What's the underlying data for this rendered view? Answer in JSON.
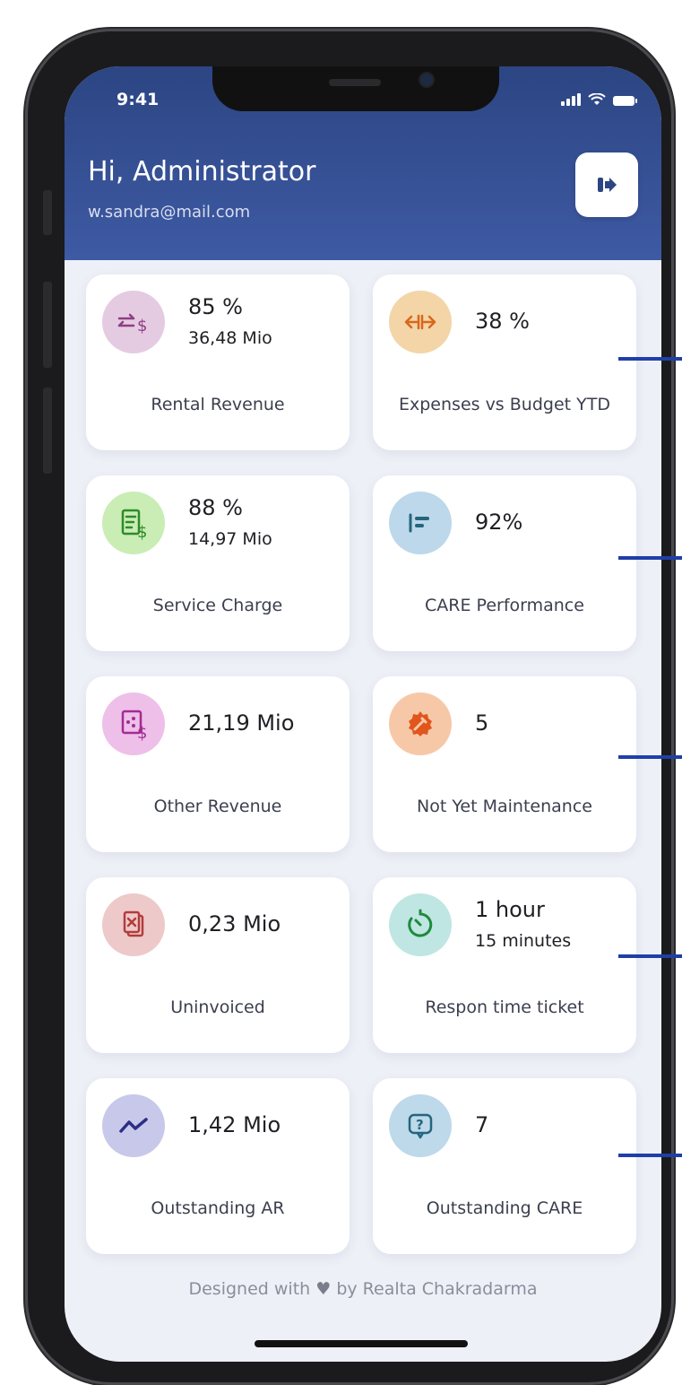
{
  "status_bar": {
    "time": "9:41"
  },
  "header": {
    "greeting": "Hi, Administrator",
    "email": "w.sandra@mail.com",
    "logout_icon": "logout-icon"
  },
  "cards": [
    {
      "value": "85 %",
      "sub": "36,48 Mio",
      "label": "Rental Revenue",
      "icon": "exchange-dollar-icon",
      "color": "#e5cbe2",
      "icon_color": "#8e3e83"
    },
    {
      "value": "38 %",
      "sub": "",
      "label": "Expenses vs Budget YTD",
      "icon": "arrows-split-icon",
      "color": "#f3d5a8",
      "icon_color": "#d9671c"
    },
    {
      "value": "88 %",
      "sub": "14,97 Mio",
      "label": "Service Charge",
      "icon": "receipt-dollar-icon",
      "color": "#c9edb4",
      "icon_color": "#2f8a2a"
    },
    {
      "value": "92%",
      "sub": "",
      "label": "CARE Performance",
      "icon": "bar-list-icon",
      "color": "#bcd8ea",
      "icon_color": "#25657d"
    },
    {
      "value": "21,19 Mio",
      "sub": "",
      "label": "Other Revenue",
      "icon": "document-dollar-icon",
      "color": "#eebfe8",
      "icon_color": "#a32b94"
    },
    {
      "value": "5",
      "sub": "",
      "label": "Not Yet Maintenance",
      "icon": "gear-wrench-icon",
      "color": "#f7c8a8",
      "icon_color": "#e0561d"
    },
    {
      "value": "0,23 Mio",
      "sub": "",
      "label": "Uninvoiced",
      "icon": "invoice-cancel-icon",
      "color": "#eec9c9",
      "icon_color": "#b23c3c"
    },
    {
      "value": "1 hour",
      "sub": "15 minutes",
      "label": "Respon time ticket",
      "icon": "timer-icon",
      "color": "#bfe6e2",
      "icon_color": "#1f8a3d"
    },
    {
      "value": "1,42 Mio",
      "sub": "",
      "label": "Outstanding AR",
      "icon": "trend-line-icon",
      "color": "#c8c8ea",
      "icon_color": "#2c2f86"
    },
    {
      "value": "7",
      "sub": "",
      "label": "Outstanding CARE",
      "icon": "help-chat-icon",
      "color": "#bdd9ea",
      "icon_color": "#25657d"
    }
  ],
  "footer": {
    "designed_with": "Designed with",
    "heart_icon": "heart-icon",
    "by": "by Realta Chakradarma"
  }
}
